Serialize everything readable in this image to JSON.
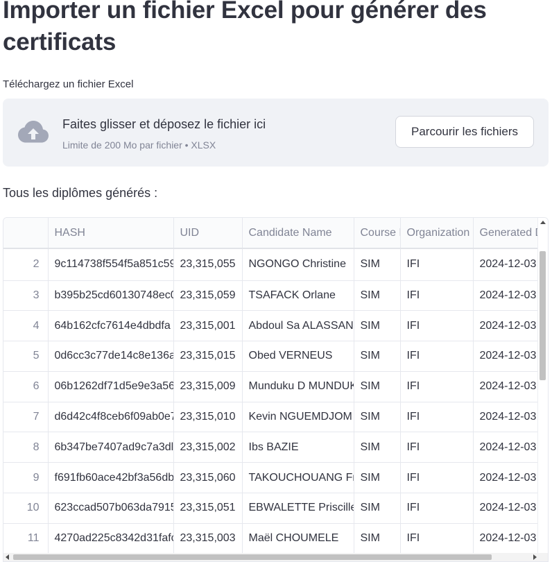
{
  "header": {
    "title": "Importer un fichier Excel pour générer des certificats"
  },
  "uploader": {
    "label": "Téléchargez un fichier Excel",
    "drop_text": "Faites glisser et déposez le fichier ici",
    "limit_text": "Limite de 200 Mo par fichier • XLSX",
    "browse_label": "Parcourir les fichiers",
    "icon": "cloud-upload-icon"
  },
  "table_section": {
    "label": "Tous les diplômes générés :",
    "columns": [
      "",
      "HASH",
      "UID",
      "Candidate Name",
      "Course Name",
      "Organization",
      "Generated Date"
    ],
    "rows": [
      {
        "index": "2",
        "hash": "9c114738f554f5a851c59",
        "uid": "23,315,055",
        "name": "NGONGO Christine",
        "course": "SIM",
        "org": "IFI",
        "date": "2024-12-03"
      },
      {
        "index": "3",
        "hash": "b395b25cd60130748ec0",
        "uid": "23,315,059",
        "name": "TSAFACK Orlane",
        "course": "SIM",
        "org": "IFI",
        "date": "2024-12-03"
      },
      {
        "index": "4",
        "hash": "64b162cfc7614e4dbdfa",
        "uid": "23,315,001",
        "name": "Abdoul Sa ALASSANI",
        "course": "SIM",
        "org": "IFI",
        "date": "2024-12-03"
      },
      {
        "index": "5",
        "hash": "0d6cc3c77de14c8e136a",
        "uid": "23,315,015",
        "name": "Obed VERNEUS",
        "course": "SIM",
        "org": "IFI",
        "date": "2024-12-03"
      },
      {
        "index": "6",
        "hash": "06b1262df71d5e9e3a56",
        "uid": "23,315,009",
        "name": " Munduku D MUNDUKU",
        "course": "SIM",
        "org": "IFI",
        "date": "2024-12-03"
      },
      {
        "index": "7",
        "hash": "d6d42c4f8ceb6f09ab0e7",
        "uid": "23,315,010",
        "name": "Kevin NGUEMDJOM",
        "course": "SIM",
        "org": "IFI",
        "date": "2024-12-03"
      },
      {
        "index": "8",
        "hash": "6b347be7407ad9c7a3dl",
        "uid": "23,315,002",
        "name": " Ibs BAZIE",
        "course": "SIM",
        "org": "IFI",
        "date": "2024-12-03"
      },
      {
        "index": "9",
        "hash": "f691fb60ace42bf3a56db",
        "uid": "23,315,060",
        "name": "TAKOUCHOUANG Fra",
        "course": "SIM",
        "org": "IFI",
        "date": "2024-12-03"
      },
      {
        "index": "10",
        "hash": "623ccad507b063da7915",
        "uid": "23,315,051",
        "name": "EBWALETTE Priscille",
        "course": "SIM",
        "org": "IFI",
        "date": "2024-12-03"
      },
      {
        "index": "11",
        "hash": "4270ad225c8342d31fafc",
        "uid": "23,315,003",
        "name": "Maël CHOUMELE",
        "course": "SIM",
        "org": "IFI",
        "date": "2024-12-03"
      }
    ]
  },
  "colors": {
    "text": "#31333f",
    "muted": "#808495",
    "dropzone_bg": "#f0f2f6",
    "icon": "#a3a8b8"
  }
}
